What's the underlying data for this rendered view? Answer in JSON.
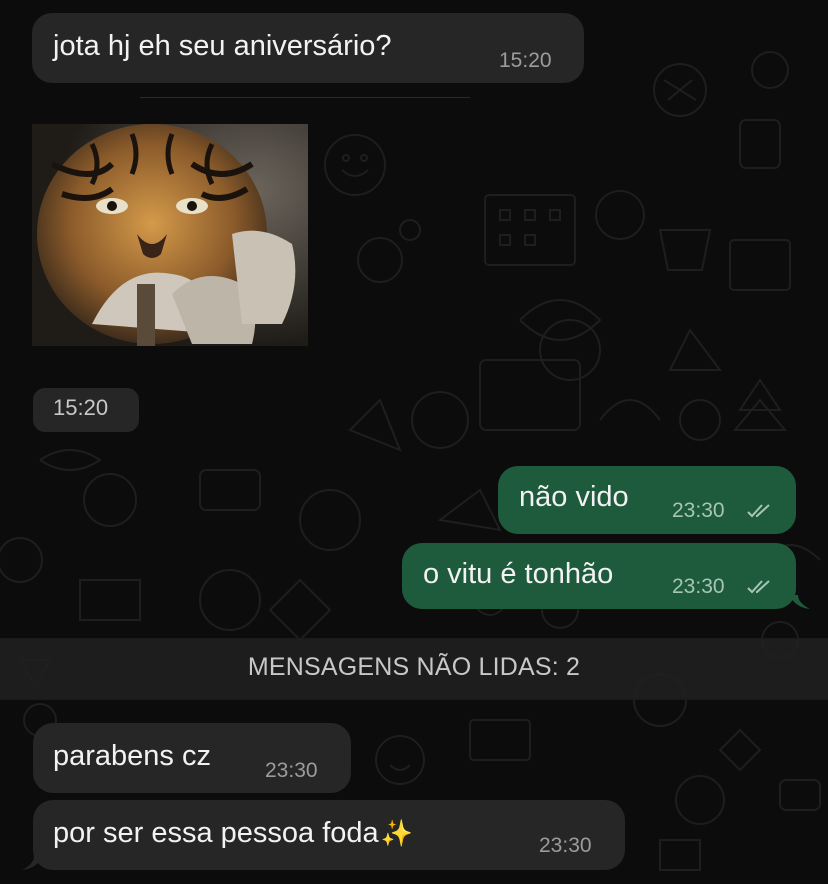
{
  "messages": [
    {
      "direction": "incoming",
      "text": "jota hj eh seu aniversário?",
      "time": "15:20"
    },
    {
      "direction": "incoming",
      "type": "image",
      "image_desc": "tiger",
      "time": "15:20"
    },
    {
      "direction": "outgoing",
      "text": "não vido",
      "time": "23:30",
      "status": "read"
    },
    {
      "direction": "outgoing",
      "text": "o vitu é tonhão",
      "time": "23:30",
      "status": "read"
    },
    {
      "direction": "incoming",
      "text": "parabens cz",
      "time": "23:30"
    },
    {
      "direction": "incoming",
      "text": "por ser essa pessoa foda",
      "emoji": "✨",
      "time": "23:30"
    }
  ],
  "unread_divider": "MENSAGENS NÃO LIDAS: 2",
  "colors": {
    "background": "#0c0c0c",
    "incoming_bubble": "#262626",
    "outgoing_bubble": "#1e5a3c",
    "text": "#f2f2f2",
    "timestamp": "#9c9c9c"
  },
  "icons": {
    "read_status": "double-check-icon",
    "emoji": "sparkles-emoji"
  }
}
